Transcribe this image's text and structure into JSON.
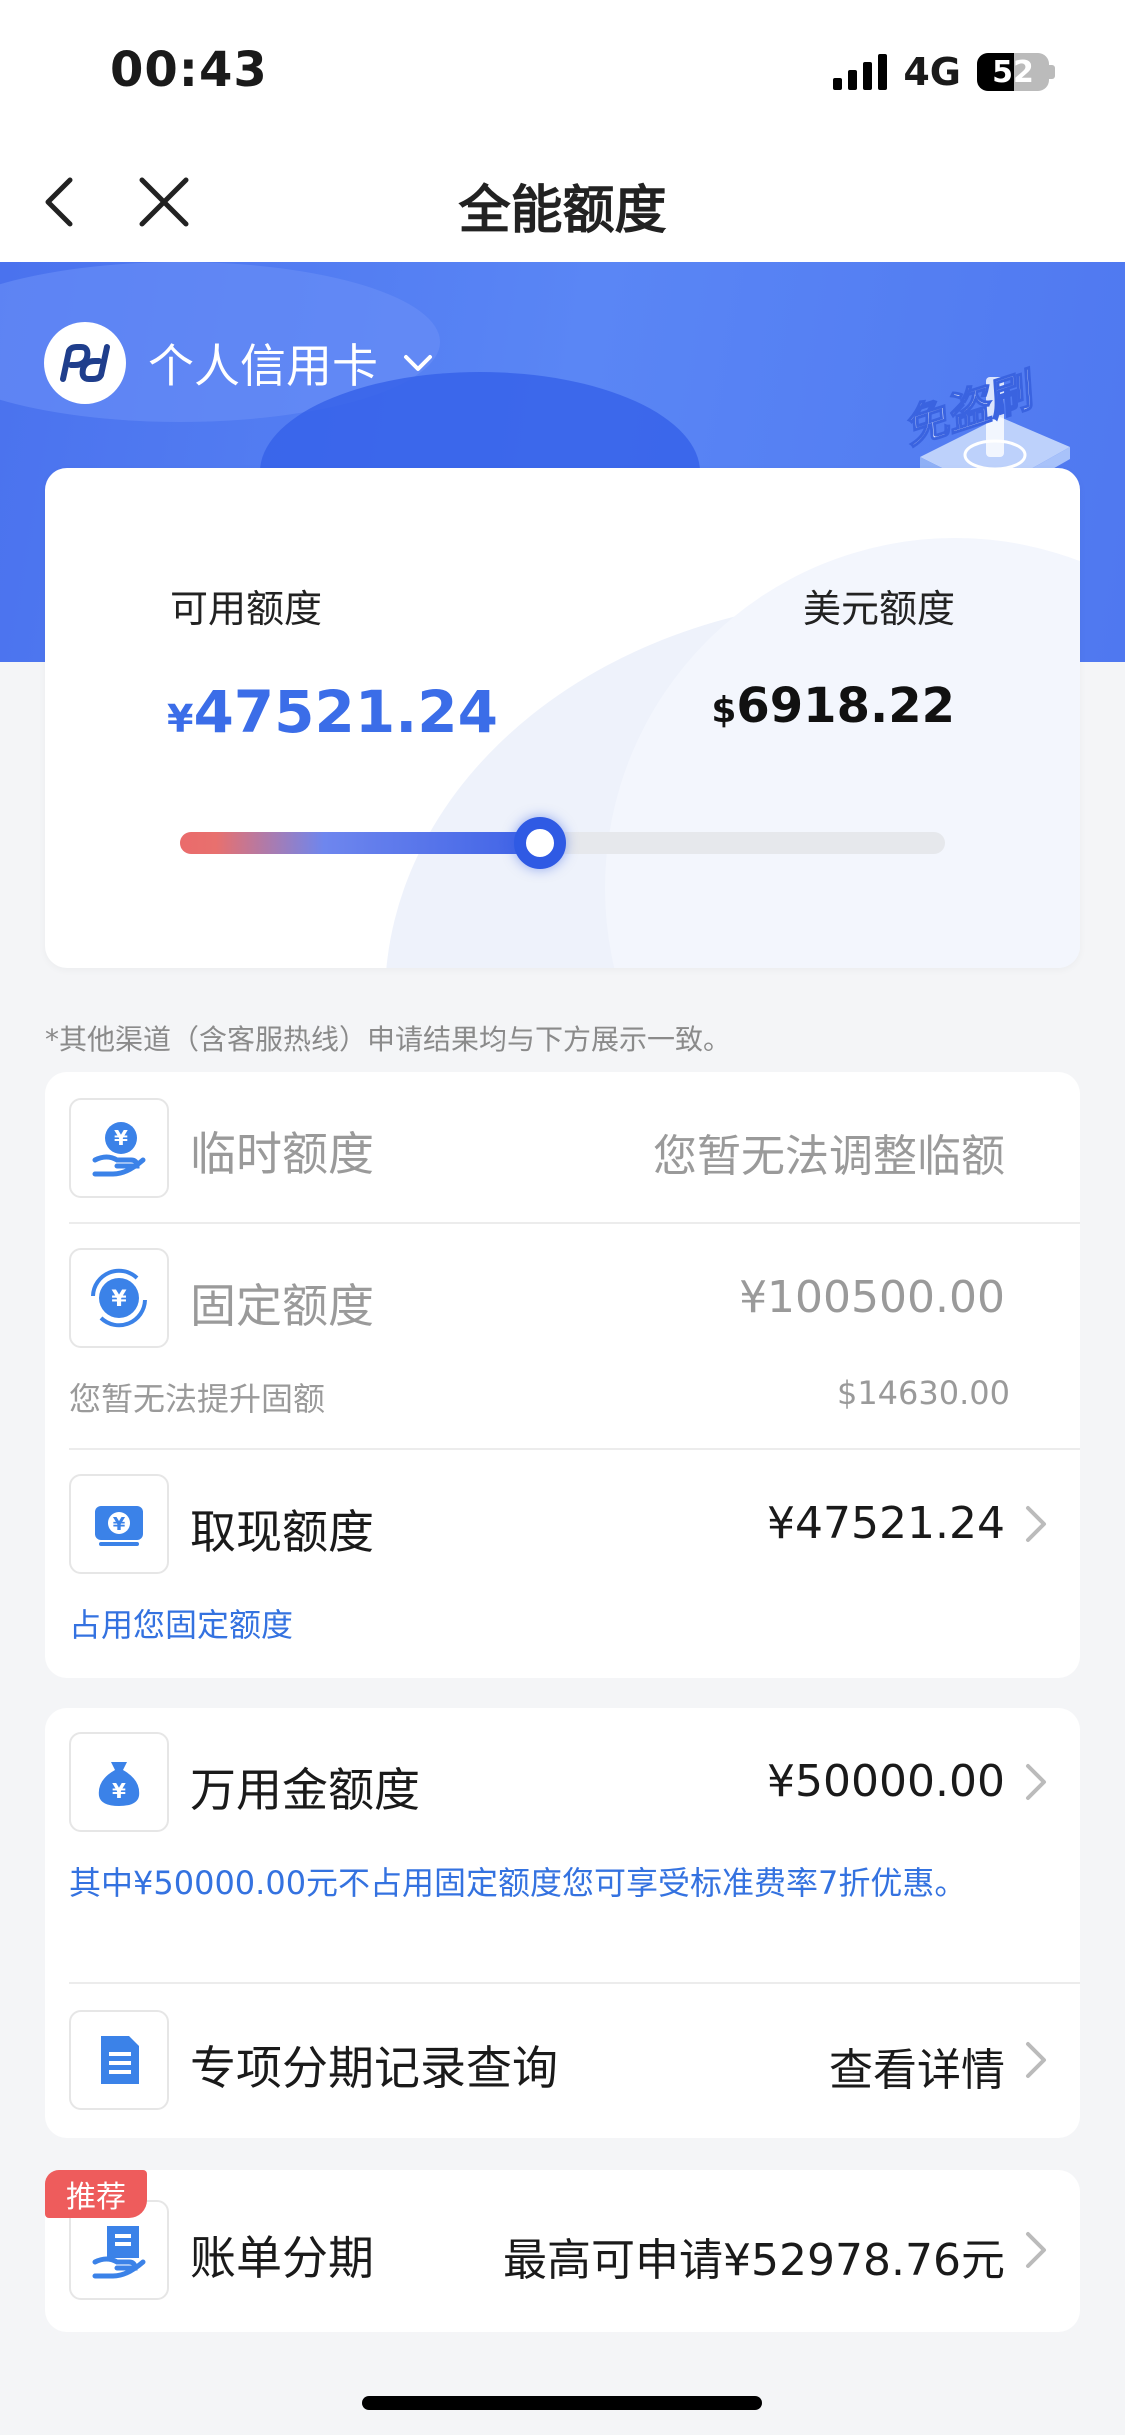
{
  "status_bar": {
    "time": "00:43",
    "network": "4G",
    "battery": "52",
    "battery_level": 0.52
  },
  "nav": {
    "title": "全能额度"
  },
  "header": {
    "card_selector": "个人信用卡",
    "badge_text": "免盗刷"
  },
  "limit": {
    "available_label": "可用额度",
    "available_currency": "¥",
    "available_value": "47521.24",
    "usd_label": "美元额度",
    "usd_currency": "$",
    "usd_value": "6918.22",
    "usage_fraction": 0.47
  },
  "notice": "*其他渠道（含客服热线）申请结果均与下方展示一致。",
  "panel1": {
    "temp": {
      "label": "临时额度",
      "value": "您暂无法调整临额"
    },
    "fixed": {
      "label": "固定额度",
      "value": "¥100500.00",
      "note": "您暂无法提升固额",
      "note_value": "$14630.00"
    },
    "cash": {
      "label": "取现额度",
      "value": "¥47521.24",
      "note": "占用您固定额度"
    }
  },
  "panel2": {
    "wanyong": {
      "label": "万用金额度",
      "value": "¥50000.00",
      "note": "其中¥50000.00元不占用固定额度您可享受标准费率7折优惠。"
    },
    "installment_records": {
      "label": "专项分期记录查询",
      "value": "查看详情"
    }
  },
  "panel3": {
    "tag": "推荐",
    "bill_installment": {
      "label": "账单分期",
      "value": "最高可申请¥52978.76元"
    }
  },
  "colors": {
    "brand_blue": "#4a72ee",
    "accent_blue": "#3b6de8",
    "tag_red": "#ee5c5c"
  }
}
